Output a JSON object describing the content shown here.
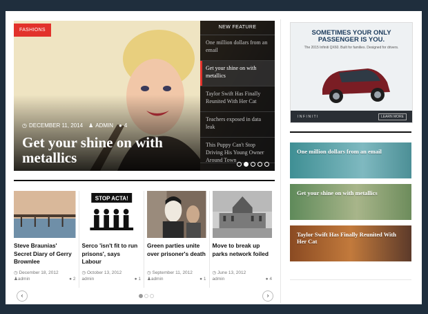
{
  "hero": {
    "category": "FASHIONS",
    "date": "DECEMBER 11, 2014",
    "author": "ADMIN",
    "comments": "4",
    "title": "Get your shine on with metallics"
  },
  "feature": {
    "heading": "NEW FEATURE",
    "items": [
      {
        "label": "One million dollars from an email"
      },
      {
        "label": "Get your shine on with metallics"
      },
      {
        "label": "Taylor Swift Has Finally Reunited With Her Cat"
      },
      {
        "label": "Teachers exposed in data leak"
      },
      {
        "label": "This Puppy Can't Stop Driving His Young Owner Around Town"
      }
    ],
    "active_index": 1,
    "slide_count": 5,
    "current_slide": 2
  },
  "cards": [
    {
      "title": "Steve Braunias' Secret Diary of Gerry Brownlee",
      "date": "December 18, 2012",
      "author": "admin",
      "comments": "2",
      "thumb": "pier-photo"
    },
    {
      "title": "Serco 'isn't fit to run prisons', says Labour",
      "date": "October 13, 2012",
      "author": "admin",
      "comments": "1",
      "thumb": "stop-acta-poster",
      "thumb_text": "STOP ACTA!"
    },
    {
      "title": "Green parties unite over prisoner's death",
      "date": "September 11, 2012",
      "author": "admin",
      "comments": "1",
      "thumb": "mask-protest-photo"
    },
    {
      "title": "Move to break up parks network foiled",
      "date": "June 13, 2012",
      "author": "admin",
      "comments": "4",
      "thumb": "city-hall-photo"
    }
  ],
  "carousel": {
    "prev": "‹",
    "next": "›",
    "page_count": 3,
    "current_page": 1
  },
  "ad": {
    "headline": "SOMETIMES YOUR ONLY PASSENGER IS YOU.",
    "subline": "The 2015 Infiniti QX60. Built for families. Designed for drivers.",
    "brand": "INFINITI",
    "cta": "LEARN MORE"
  },
  "sidebar": [
    {
      "label": "One million dollars from an email",
      "color": "#3f8f94"
    },
    {
      "label": "Get your shine on with metallics",
      "color": "#5f8a5a"
    },
    {
      "label": "Taylor Swift Has Finally Reunited With Her Cat",
      "color": "#8a4a22"
    }
  ],
  "colors": {
    "accent": "#e2322b",
    "background": "#1f2e3d"
  }
}
